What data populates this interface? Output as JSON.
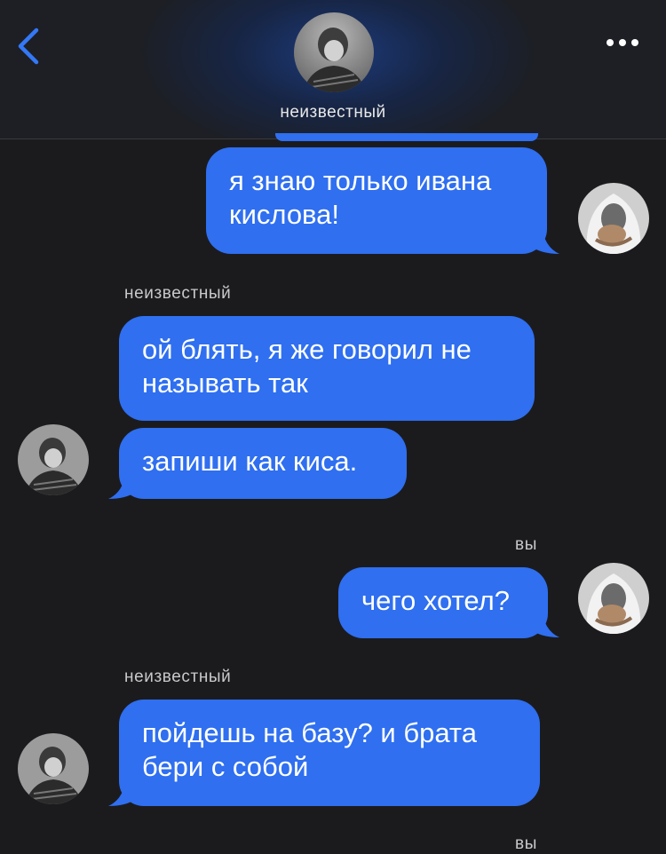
{
  "header": {
    "contact_name": "неизвестный",
    "back_icon": "chevron-left-icon",
    "more_icon": "ellipsis-icon"
  },
  "colors": {
    "bubble": "#2f6ff0",
    "background": "#1b1b1e",
    "accent": "#2f6ff0"
  },
  "messages": [
    {
      "sender": "you",
      "text_lines": [
        "я знаю только ивана",
        "кислова!"
      ]
    },
    {
      "sender": "unknown",
      "label": "неизвестный",
      "text_lines": [
        "ой блять, я же говорил не",
        "называть так"
      ]
    },
    {
      "sender": "unknown",
      "text_lines": [
        "запиши как киса."
      ]
    },
    {
      "sender": "you",
      "label": "вы",
      "text_lines": [
        "чего хотел?"
      ]
    },
    {
      "sender": "unknown",
      "label": "неизвестный",
      "text_lines": [
        "пойдешь на базу? и брата",
        "бери с собой"
      ]
    }
  ],
  "footer_partial_label": "вы"
}
